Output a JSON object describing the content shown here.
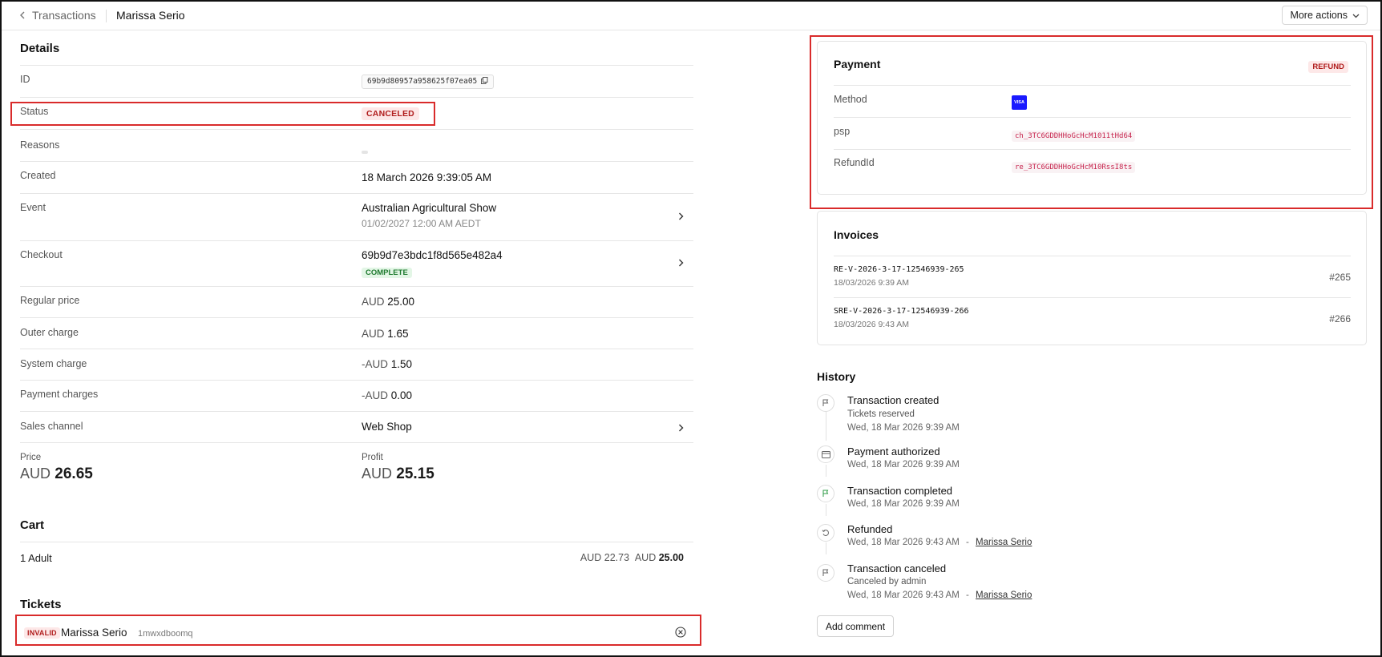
{
  "header": {
    "back_label": "Transactions",
    "title": "Marissa Serio",
    "more_actions": "More actions"
  },
  "details": {
    "heading": "Details",
    "id_label": "ID",
    "id_value": "69b9d80957a958625f07ea05",
    "status_label": "Status",
    "status_value": "CANCELED",
    "reasons_label": "Reasons",
    "created_label": "Created",
    "created_value": "18 March 2026 9:39:05 AM",
    "event_label": "Event",
    "event_name": "Australian Agricultural Show",
    "event_date": "01/02/2027 12:00 AM AEDT",
    "checkout_label": "Checkout",
    "checkout_id": "69b9d7e3bdc1f8d565e482a4",
    "checkout_status": "COMPLETE",
    "regular_price_label": "Regular price",
    "regular_price_currency": "AUD",
    "regular_price_amount": "25.00",
    "outer_charge_label": "Outer charge",
    "outer_charge_currency": "AUD",
    "outer_charge_amount": "1.65",
    "system_charge_label": "System charge",
    "system_charge_currency": "-AUD",
    "system_charge_amount": "1.50",
    "payment_charges_label": "Payment charges",
    "payment_charges_currency": "-AUD",
    "payment_charges_amount": "0.00",
    "sales_channel_label": "Sales channel",
    "sales_channel_value": "Web Shop",
    "price_label": "Price",
    "price_currency": "AUD",
    "price_amount": "26.65",
    "profit_label": "Profit",
    "profit_currency": "AUD",
    "profit_amount": "25.15"
  },
  "cart": {
    "heading": "Cart",
    "item_qty": "1",
    "item_name": "Adult",
    "item_unit_price": "AUD 22.73",
    "item_total_currency": "AUD",
    "item_total_amount": "25.00"
  },
  "tickets": {
    "heading": "Tickets",
    "status": "INVALID",
    "holder": "Marissa Serio",
    "code": "1mwxdboomq"
  },
  "payment": {
    "heading": "Payment",
    "type_badge": "REFUND",
    "method_label": "Method",
    "method_icon": "visa-icon",
    "method_text": "VISA",
    "psp_label": "psp",
    "psp_value": "ch_3TC6GDDHHoGcHcM1011tHd64",
    "refundid_label": "RefundId",
    "refundid_value": "re_3TC6GDDHHoGcHcM10RssI8ts"
  },
  "invoices": {
    "heading": "Invoices",
    "items": [
      {
        "id": "RE-V-2026-3-17-12546939-265",
        "date": "18/03/2026 9:39 AM",
        "number": "#265"
      },
      {
        "id": "SRE-V-2026-3-17-12546939-266",
        "date": "18/03/2026 9:43 AM",
        "number": "#266"
      }
    ]
  },
  "history": {
    "heading": "History",
    "link_separator": "-",
    "items": [
      {
        "title": "Transaction created",
        "sub": "Tickets reserved",
        "date": "Wed, 18 Mar 2026 9:39 AM",
        "icon": "flag-icon"
      },
      {
        "title": "Payment authorized",
        "date": "Wed, 18 Mar 2026 9:39 AM",
        "icon": "credit-card-icon"
      },
      {
        "title": "Transaction completed",
        "date": "Wed, 18 Mar 2026 9:39 AM",
        "icon": "flag-icon"
      },
      {
        "title": "Refunded",
        "date": "Wed, 18 Mar 2026 9:43 AM",
        "user": "Marissa Serio",
        "icon": "undo-icon"
      },
      {
        "title": "Transaction canceled",
        "sub": "Canceled by admin",
        "date": "Wed, 18 Mar 2026 9:43 AM",
        "user": "Marissa Serio",
        "icon": "flag-icon"
      }
    ],
    "add_comment": "Add comment"
  },
  "colors": {
    "highlight_border": "#d92b2b",
    "badge_red_bg": "#fde8e8",
    "badge_red_text": "#b01c1c",
    "badge_green_bg": "#e3f6e6",
    "badge_green_text": "#1e7a2e",
    "visa_blue": "#1a1aff",
    "code_text": "#c7254e"
  }
}
